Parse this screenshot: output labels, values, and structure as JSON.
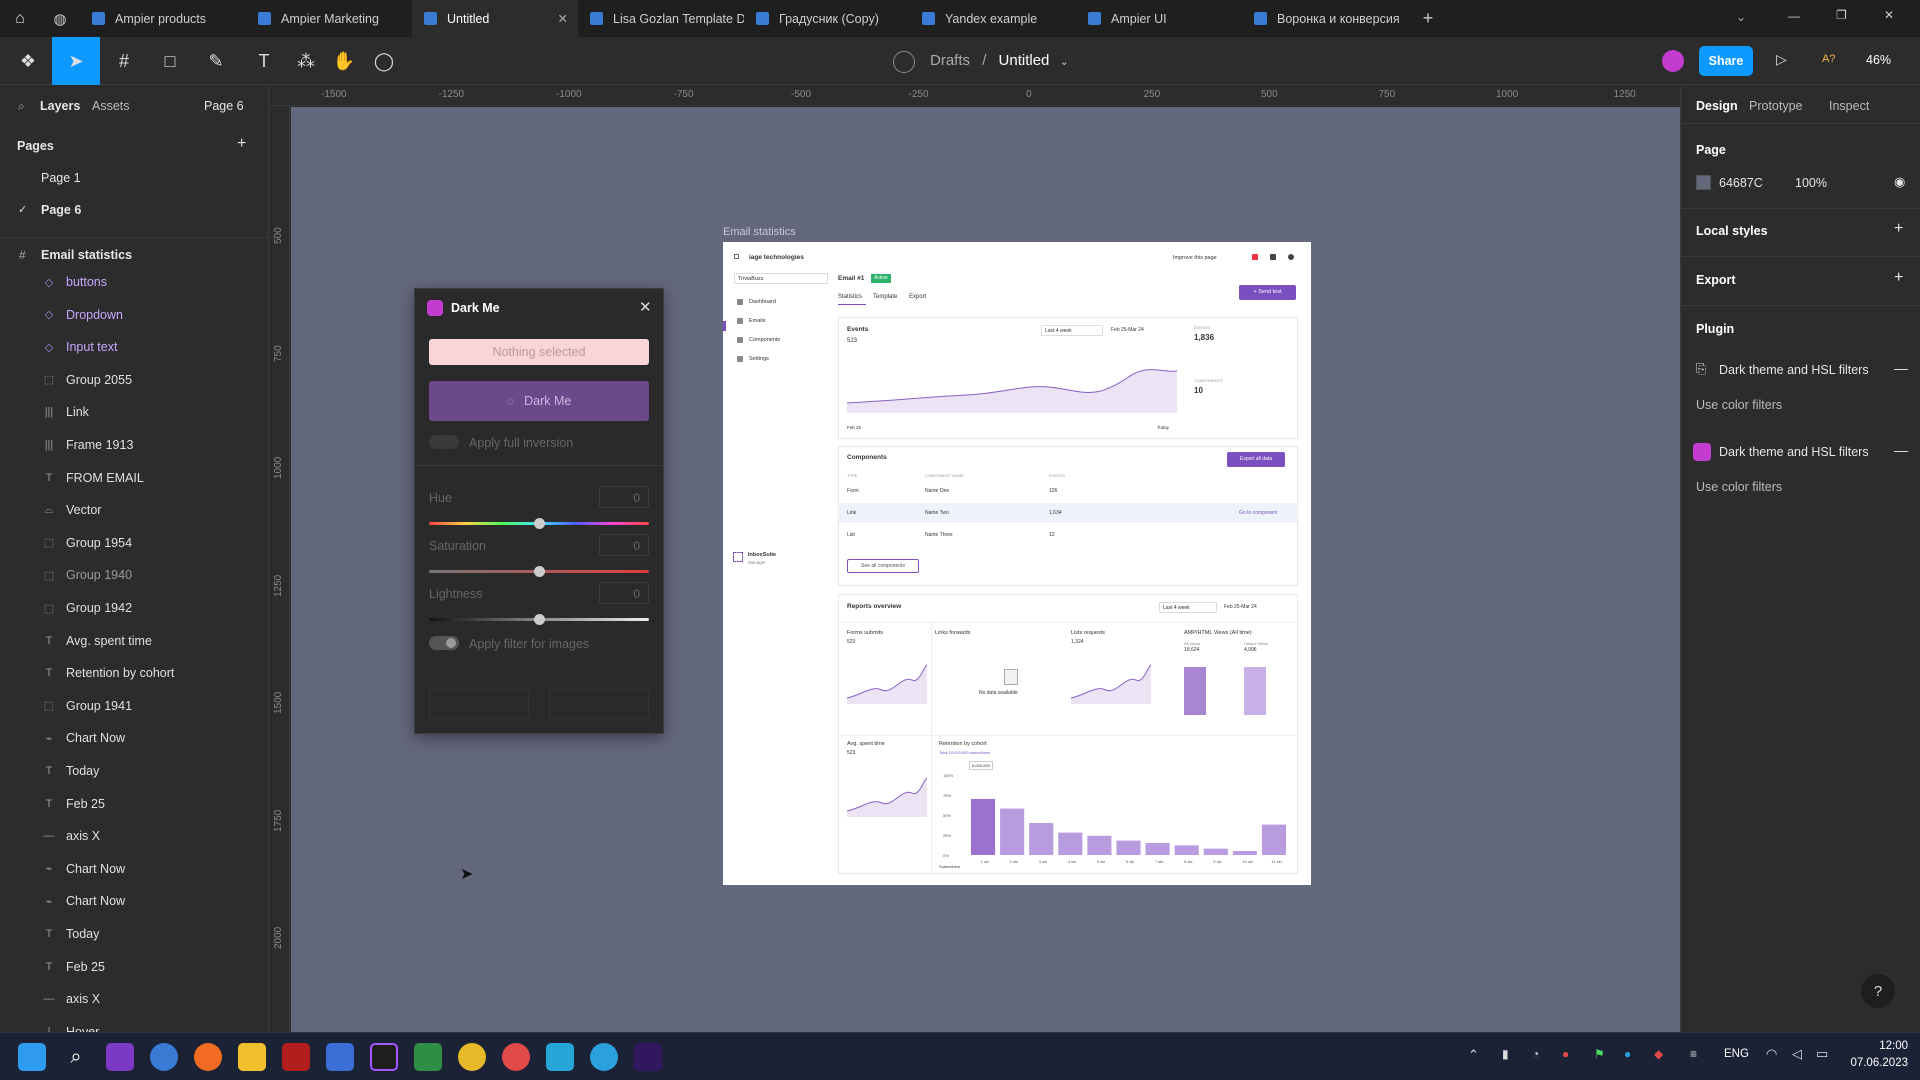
{
  "tabs": [
    {
      "label": "Ampier products"
    },
    {
      "label": "Ampier Marketing"
    },
    {
      "label": "Untitled",
      "active": true
    },
    {
      "label": "Lisa Gozlan Template Design (Copy)"
    },
    {
      "label": "Градусник (Copy)"
    },
    {
      "label": "Yandex example"
    },
    {
      "label": "Ampier UI"
    },
    {
      "label": "Воронка и конверсия"
    }
  ],
  "toolbar": {
    "breadcrumb_root": "Drafts",
    "breadcrumb_sep": "/",
    "file_name": "Untitled",
    "share": "Share",
    "zoom": "46%",
    "a11y": "A?"
  },
  "left": {
    "tab_layers": "Layers",
    "tab_assets": "Assets",
    "page_selector": "Page 6",
    "pages_title": "Pages",
    "pages": [
      "Page 1",
      "Page 6"
    ],
    "frame_name": "Email statistics",
    "layers": [
      {
        "name": "buttons",
        "icon": "◇",
        "style": "purple"
      },
      {
        "name": "Dropdown",
        "icon": "◇",
        "style": "purple"
      },
      {
        "name": "Input text",
        "icon": "◇",
        "style": "purple"
      },
      {
        "name": "Group 2055",
        "icon": "⬚"
      },
      {
        "name": "Link",
        "icon": "|||"
      },
      {
        "name": "Frame 1913",
        "icon": "|||"
      },
      {
        "name": "FROM EMAIL",
        "icon": "T"
      },
      {
        "name": "Vector",
        "icon": "⌓"
      },
      {
        "name": "Group 1954",
        "icon": "⬚"
      },
      {
        "name": "Group 1940",
        "icon": "⬚",
        "style": "dim"
      },
      {
        "name": "Group 1942",
        "icon": "⬚"
      },
      {
        "name": "Avg. spent time",
        "icon": "T"
      },
      {
        "name": "Retention by cohort",
        "icon": "T"
      },
      {
        "name": "Group 1941",
        "icon": "⬚"
      },
      {
        "name": "Chart Now",
        "icon": "⌁"
      },
      {
        "name": "Today",
        "icon": "T"
      },
      {
        "name": "Feb 25",
        "icon": "T"
      },
      {
        "name": "axis X",
        "icon": "—"
      },
      {
        "name": "Chart Now",
        "icon": "⌁"
      },
      {
        "name": "Chart Now",
        "icon": "⌁"
      },
      {
        "name": "Today",
        "icon": "T"
      },
      {
        "name": "Feb 25",
        "icon": "T"
      },
      {
        "name": "axis X",
        "icon": "—"
      },
      {
        "name": "Hover",
        "icon": "|"
      }
    ]
  },
  "ruler_top": [
    "-1500",
    "-1250",
    "-1000",
    "-750",
    "-500",
    "-250",
    "0",
    "250",
    "500",
    "750",
    "1000",
    "1250"
  ],
  "ruler_left": [
    "500",
    "750",
    "1000",
    "1250",
    "1500",
    "1750",
    "2000"
  ],
  "right": {
    "tab_design": "Design",
    "tab_prototype": "Prototype",
    "tab_inspect": "Inspect",
    "page_title": "Page",
    "page_color": "64687C",
    "page_opacity": "100%",
    "local_styles": "Local styles",
    "export": "Export",
    "plugin": "Plugin",
    "plugins": [
      {
        "name": "Dark theme and HSL filters",
        "sub": "Use color filters"
      },
      {
        "name": "Dark theme and HSL filters",
        "sub": "Use color filters"
      }
    ]
  },
  "plugin": {
    "title": "Dark Me",
    "nothing": "Nothing selected",
    "run": "Dark Me",
    "full_inversion": "Apply full inversion",
    "hue": "Hue",
    "hue_val": "0",
    "saturation": "Saturation",
    "sat_val": "0",
    "lightness": "Lightness",
    "light_val": "0",
    "apply_images": "Apply filter for images",
    "hue_pos": 0.5,
    "sat_pos": 0.5,
    "light_pos": 0.5
  },
  "frame": {
    "label": "Email statistics",
    "brand": "iage technologies",
    "improve": "Improve this page",
    "select": "TriviaBuzz",
    "email": "Email #1",
    "badge": "Active",
    "tabs": [
      "Statistics",
      "Template",
      "Export"
    ],
    "send": "+ Send test",
    "nav": [
      "Dashboard",
      "Emails",
      "Components",
      "Settings"
    ],
    "inbox": "InboxSuite",
    "inbox_sub": "Manager",
    "events_title": "Events",
    "events_val": "523",
    "events_range": "Last 4 week",
    "events_date": "Feb 25-Mar 24",
    "stat1_label": "EVENTS",
    "stat1": "1,836",
    "stat2_label": "COMPONENTS",
    "stat2": "10",
    "feb25": "Feb 25",
    "today": "Today",
    "components_title": "Components",
    "export_all": "Export all data",
    "col_type": "TYPE",
    "col_name": "COMPONENT NAME",
    "col_events": "EVENTS",
    "rows": [
      {
        "type": "Form",
        "name": "Name One",
        "events": "126"
      },
      {
        "type": "Link",
        "name": "Name Two",
        "events": "1,634",
        "link": "Go to component"
      },
      {
        "type": "List",
        "name": "Name Three",
        "events": "12"
      }
    ],
    "see_all": "See all components",
    "reports": "Reports overview",
    "rep_range": "Last 4 week",
    "rep_date": "Feb 25-Mar 24",
    "r1": "Forms submits",
    "r1v": "523",
    "r2": "Links forwards",
    "r2nd": "No data available",
    "r3": "Lists requests",
    "r3v": "1,324",
    "r4": "AMP/HTML Views (All time)",
    "r4a": "All Views",
    "r4av": "19,624",
    "r4b": "Unique Views",
    "r4bv": "4,996",
    "r5": "Avg. spent time",
    "r5v": "523",
    "r6": "Retention by cohort",
    "r6sub": "Total 10,000,000 subscribers",
    "r6tip": "6,000,000",
    "r6y": "Subscribers"
  },
  "chart_data": {
    "type": "bar",
    "title": "Retention by cohort",
    "ylabel": "Subscribers",
    "categories": [
      "1 ski",
      "2 ski",
      "3 ski",
      "4 ski",
      "5 ski",
      "6 ski",
      "7 ski",
      "8 ski",
      "9 ski",
      "10 ski",
      "11 ski"
    ],
    "values": [
      70,
      58,
      40,
      28,
      24,
      18,
      15,
      12,
      8,
      5,
      38
    ],
    "ylim": [
      0,
      100
    ],
    "yticks": [
      "100%",
      "75%",
      "50%",
      "25%",
      "0%"
    ]
  },
  "taskbar": {
    "lang": "ENG",
    "time": "12:00",
    "date": "07.06.2023"
  }
}
